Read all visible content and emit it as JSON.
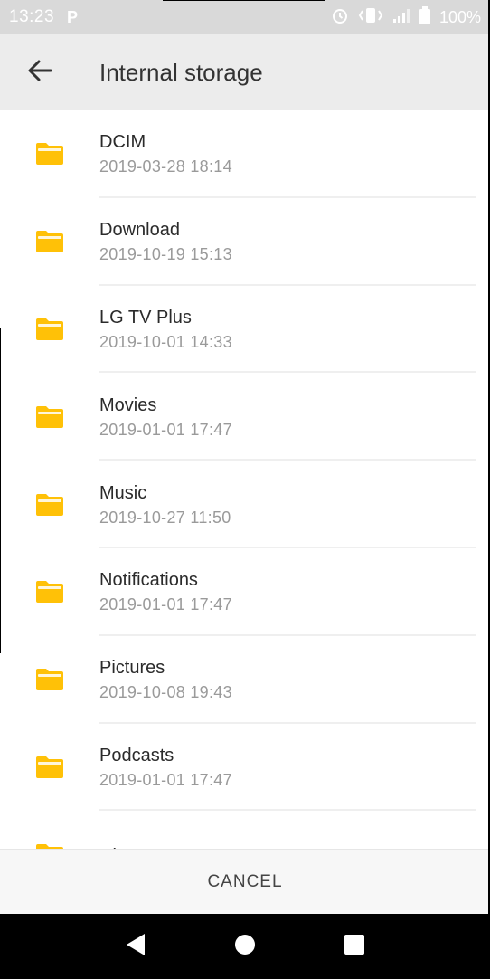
{
  "status_bar": {
    "time": "13:23",
    "notification_glyph": "P",
    "battery_text": "100%",
    "icons": [
      "alarm-icon",
      "vibrate-icon",
      "signal-icon",
      "battery-icon"
    ]
  },
  "app_bar": {
    "title": "Internal storage",
    "back_icon": "arrow-back-icon"
  },
  "folders": [
    {
      "name": "DCIM",
      "date": "2019-03-28 18:14"
    },
    {
      "name": "Download",
      "date": "2019-10-19 15:13"
    },
    {
      "name": "LG TV Plus",
      "date": "2019-10-01 14:33"
    },
    {
      "name": "Movies",
      "date": "2019-01-01 17:47"
    },
    {
      "name": "Music",
      "date": "2019-10-27 11:50"
    },
    {
      "name": "Notifications",
      "date": "2019-01-01 17:47"
    },
    {
      "name": "Pictures",
      "date": "2019-10-08 19:43"
    },
    {
      "name": "Podcasts",
      "date": "2019-01-01 17:47"
    },
    {
      "name": "Ringtones",
      "date": ""
    }
  ],
  "bottom": {
    "cancel_label": "CANCEL"
  },
  "nav": {
    "icons": [
      "back-triangle-icon",
      "home-circle-icon",
      "recents-square-icon"
    ]
  },
  "colors": {
    "folder": "#FFC107",
    "folder_tab": "#FFD54F",
    "status_bar_bg": "#D9D9D9",
    "app_bar_bg": "#ECECEC",
    "nav_bar_bg": "#000000"
  }
}
